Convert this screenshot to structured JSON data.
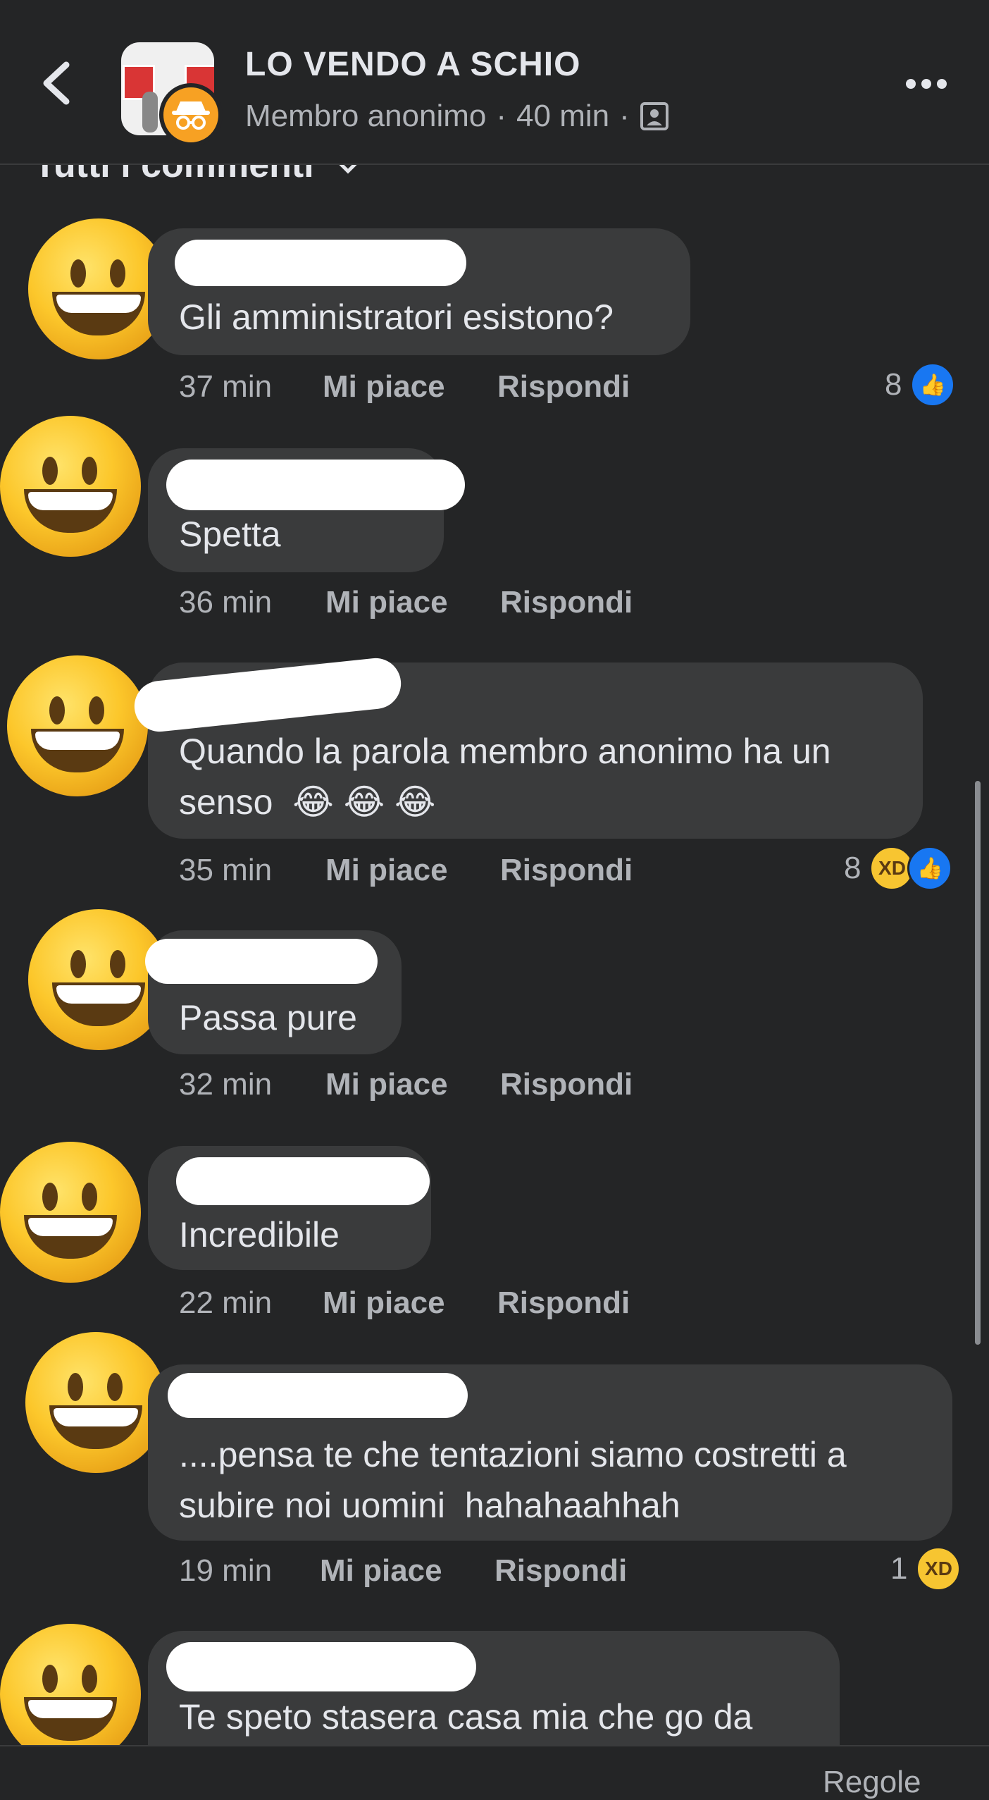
{
  "header": {
    "title": "LO VENDO A SCHIO",
    "author": "Membro anonimo",
    "time": "40 min",
    "separator": "·"
  },
  "filter_label": "Tutti i commenti",
  "comments": [
    {
      "text_lines": [
        "Gli amministratori esistono?"
      ],
      "time": "37 min",
      "like": "Mi piace",
      "reply": "Rispondi",
      "reaction_count": "8",
      "reactions": [
        "like"
      ]
    },
    {
      "text_lines": [
        "Spetta"
      ],
      "time": "36 min",
      "like": "Mi piace",
      "reply": "Rispondi"
    },
    {
      "text_lines": [
        "Quando la parola membro anonimo ha un",
        "senso"
      ],
      "emoji": [
        "😂",
        "😂",
        "😂"
      ],
      "time": "35 min",
      "like": "Mi piace",
      "reply": "Rispondi",
      "reaction_count": "8",
      "reactions": [
        "haha",
        "like"
      ]
    },
    {
      "text_lines": [
        "Passa pure"
      ],
      "time": "32 min",
      "like": "Mi piace",
      "reply": "Rispondi"
    },
    {
      "text_lines": [
        "Incredibile"
      ],
      "time": "22 min",
      "like": "Mi piace",
      "reply": "Rispondi"
    },
    {
      "text_lines": [
        "....pensa te che tentazioni siamo costretti a",
        "subire noi uomini  hahahaahhah"
      ],
      "time": "19 min",
      "like": "Mi piace",
      "reply": "Rispondi",
      "reaction_count": "1",
      "reactions": [
        "haha"
      ]
    },
    {
      "text_lines": [
        "Te speto stasera casa mia che go da"
      ]
    }
  ],
  "footer_label": "Regole",
  "colors": {
    "background": "#242526",
    "bubble": "#3a3b3c",
    "like": "#1877f2",
    "anon_badge": "#f7a123"
  }
}
